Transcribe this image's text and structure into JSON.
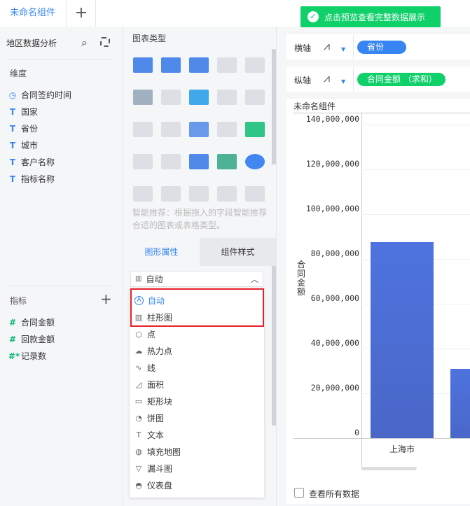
{
  "tabs": {
    "active": "未命名组件",
    "add": "+"
  },
  "toast": {
    "text": "点击预览查看完整数据展示",
    "color": "#10d06a"
  },
  "left": {
    "dataset": "地区数据分析",
    "dimension_title": "维度",
    "dimensions": [
      {
        "icon": "clock-icon",
        "label": "合同签约时间"
      },
      {
        "icon": "text-type-icon",
        "label": "国家"
      },
      {
        "icon": "text-type-icon",
        "label": "省份"
      },
      {
        "icon": "text-type-icon",
        "label": "城市"
      },
      {
        "icon": "text-type-icon",
        "label": "客户名称"
      },
      {
        "icon": "text-type-icon",
        "label": "指标名称"
      }
    ],
    "measure_title": "指标",
    "measures": [
      {
        "icon": "#",
        "label": "合同金额"
      },
      {
        "icon": "#",
        "label": "回款金额"
      },
      {
        "icon": "#*",
        "label": "记录数"
      }
    ]
  },
  "mid": {
    "chart_type_title": "图表类型",
    "hint": "智能推荐：根据拖入的字段智能推荐合适的图表或表格类型。",
    "tab_attr": "图形属性",
    "tab_style": "组件样式",
    "select_value": "自动",
    "options": [
      {
        "icon": "A",
        "label": "自动",
        "selected": true
      },
      {
        "icon": "▥",
        "label": "柱形图"
      },
      {
        "icon": "○",
        "label": "点"
      },
      {
        "icon": "☁",
        "label": "热力点"
      },
      {
        "icon": "∿",
        "label": "线"
      },
      {
        "icon": "◿",
        "label": "面积"
      },
      {
        "icon": "▭",
        "label": "矩形块"
      },
      {
        "icon": "◔",
        "label": "饼图"
      },
      {
        "icon": "T",
        "label": "文本"
      },
      {
        "icon": "◍",
        "label": "填充地图"
      },
      {
        "icon": "▽",
        "label": "漏斗图"
      },
      {
        "icon": "◓",
        "label": "仪表盘"
      }
    ]
  },
  "axes": {
    "x_label": "横轴",
    "x_field": "省份",
    "y_label": "纵轴",
    "y_field": "合同金额 （求和）"
  },
  "component_title": "未命名组件",
  "show_all": "查看所有数据",
  "chart_data": {
    "type": "bar",
    "ylabel": "合同金额",
    "categories": [
      "上海市",
      ""
    ],
    "values": [
      87500000,
      31000000
    ],
    "ylim": [
      0,
      140000000
    ],
    "yticks": [
      "0",
      "20,000,000",
      "40,000,000",
      "60,000,000",
      "80,000,000",
      "100,000,000",
      "120,000,000",
      "140,000,000"
    ],
    "color": "#4e73de"
  }
}
